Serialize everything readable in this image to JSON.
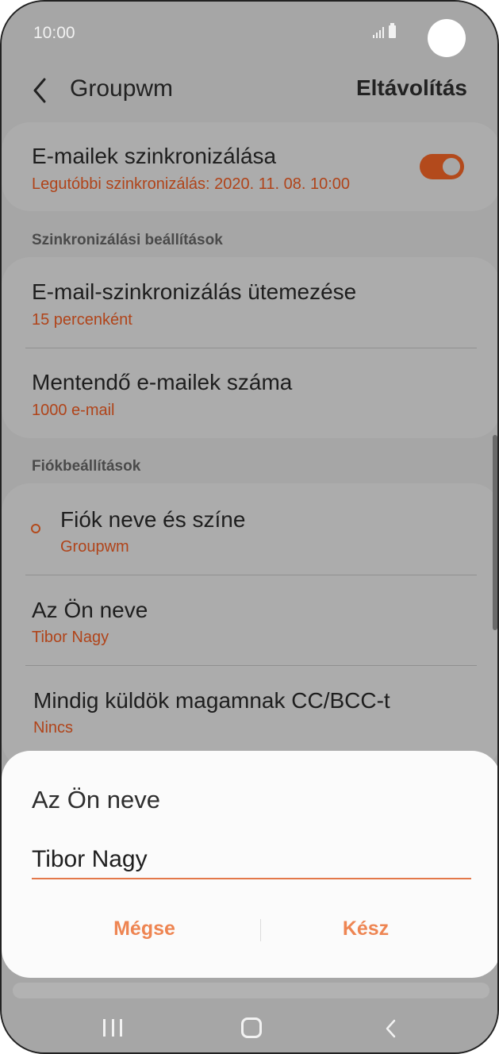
{
  "status_bar": {
    "time": "10:00"
  },
  "header": {
    "title": "Groupwm",
    "action": "Eltávolítás"
  },
  "sync": {
    "title": "E-mailek szinkronizálása",
    "subtitle": "Legutóbbi szinkronizálás: 2020. 11. 08.  10:00",
    "enabled": true
  },
  "sync_settings": {
    "label": "Szinkronizálási beállítások",
    "items": [
      {
        "title": "E-mail-szinkronizálás ütemezése",
        "value": "15 percenként"
      },
      {
        "title": "Mentendő e-mailek száma",
        "value": "1000 e-mail"
      }
    ]
  },
  "account_settings": {
    "label": "Fiókbeállítások",
    "items": [
      {
        "title": "Fiók neve és színe",
        "value": "Groupwm"
      },
      {
        "title": "Az Ön neve",
        "value": "Tibor Nagy"
      },
      {
        "title": "Mindig küldök magamnak CC/BCC-t",
        "value": "Nincs"
      }
    ]
  },
  "dialog": {
    "title": "Az Ön neve",
    "input_value": "Tibor Nagy",
    "cancel_label": "Mégse",
    "done_label": "Kész"
  },
  "colors": {
    "accent": "#b0441a",
    "dialog_accent": "#ee8552"
  },
  "icons": {
    "back": "chevron-left-icon",
    "account_color": "circle-icon",
    "nav_recent": "recent-apps-icon",
    "nav_home": "home-icon",
    "nav_back": "nav-back-icon"
  }
}
